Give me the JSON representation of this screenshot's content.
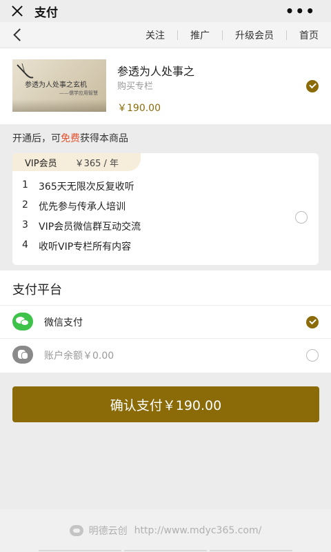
{
  "topbar": {
    "title": "支付",
    "more": "•••"
  },
  "nav": {
    "links": [
      "关注",
      "推广",
      "升级会员",
      "首页"
    ]
  },
  "product": {
    "thumb_title": "参透为人处事之玄机",
    "thumb_sub": "——儒学应用智慧",
    "name": "参透为人处事之",
    "type": "购买专栏",
    "price": "￥190.00"
  },
  "open_tip": {
    "before": "开通后，可",
    "free": "免费",
    "after": "获得本商品"
  },
  "vip": {
    "name": "VIP会员",
    "price": "￥365 / 年",
    "benefits": [
      {
        "num": "1",
        "text": "365天无限次反复收听"
      },
      {
        "num": "2",
        "text": "优先参与传承人培训"
      },
      {
        "num": "3",
        "text": "VIP会员微信群互动交流"
      },
      {
        "num": "4",
        "text": "收听VIP专栏所有内容"
      }
    ]
  },
  "payment": {
    "title": "支付平台",
    "options": [
      {
        "label": "微信支付",
        "selected": true,
        "icon": "wechat-pay-icon"
      },
      {
        "label": "账户余额￥0.00",
        "selected": false,
        "icon": "wallet-balance-icon"
      }
    ]
  },
  "confirm_label": "确认支付￥190.00",
  "footer": {
    "brand": "明德云创",
    "url": "http://www.mdyc365.com/"
  },
  "colors": {
    "accent": "#8b6a08",
    "free": "#e2522f",
    "wechat": "#3ec24a"
  }
}
